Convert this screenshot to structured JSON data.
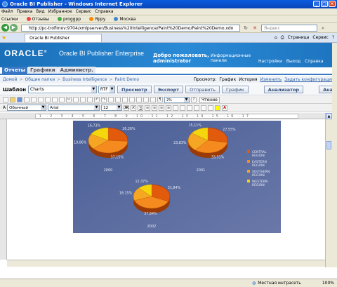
{
  "window": {
    "title": "Oracle BI Publisher - Windows Internet Explorer"
  },
  "menu": [
    "Файл",
    "Правка",
    "Вид",
    "Избранное",
    "Сервис",
    "Справка"
  ],
  "links_bar": [
    "Ссылки",
    "Отзывы",
    "proggpp",
    "Ярру",
    "Москва"
  ],
  "address": {
    "url": "http://pc-trofimov:9704/xmlpserver/Business%20Intelligence/Paint%20Demo/Paint%20Demo.xdo",
    "search_placeholder": "Яндекс"
  },
  "browser_tab": {
    "label": "Oracle BI Publisher",
    "tools": [
      "Страница",
      "Сервис"
    ]
  },
  "banner": {
    "brand": "ORACLE",
    "product": "Oracle BI Publisher Enterprise",
    "welcome_line1": "Добро пожаловать,",
    "welcome_line2": "administrator",
    "info_panel_line1": "Информационные",
    "info_panel_line2": "панели",
    "links": [
      "Настройки",
      "Выход",
      "Справка"
    ]
  },
  "app_tabs": [
    {
      "label": "Отчеты",
      "active": true
    },
    {
      "label": "Графики",
      "active": false
    },
    {
      "label": "Администр.",
      "active": false
    }
  ],
  "breadcrumb": {
    "items": [
      "Домой",
      "Общие папки",
      "Business Intelligence",
      "Paint Demo"
    ]
  },
  "view_links": {
    "label": "Просмотр:",
    "items": [
      "График",
      "История",
      "Изменить",
      "Задать конфигурацию"
    ]
  },
  "template_bar": {
    "label": "Шаблон",
    "template_value": "Charts",
    "format_value": "RTF",
    "buttons": [
      "Просмотр",
      "Экспорт",
      "Отправить",
      "График",
      "Анализатор",
      "Ана"
    ]
  },
  "format_bar": {
    "style": "Обычный",
    "font": "Arial",
    "size": "12",
    "zoom": "2%",
    "reading": "Чтение"
  },
  "status": {
    "zone": "Местная интрасеть",
    "zoom": "100%"
  },
  "chart_data": [
    {
      "type": "pie",
      "title": "2000",
      "categories": [
        "CENTRAL REGION",
        "EASTERN REGION",
        "SOUTHERN REGION",
        "WESTERN REGION"
      ],
      "values": [
        26.26,
        37.15,
        19.86,
        16.73
      ],
      "labels": [
        "26,26%",
        "37,15%",
        "19,86%",
        "16,73%"
      ],
      "legend": "right",
      "colors": [
        "#e25b0c",
        "#f58a1e",
        "#f5a623",
        "#f5d60c"
      ]
    },
    {
      "type": "pie",
      "title": "2001",
      "categories": [
        "CENTRAL REGION",
        "EASTERN REGION",
        "SOUTHERN REGION",
        "WESTERN REGION"
      ],
      "values": [
        27.55,
        33.51,
        23.83,
        15.11
      ],
      "labels": [
        "27,55%",
        "33,51%",
        "23,83%",
        "15,11%"
      ],
      "legend": "right",
      "colors": [
        "#e25b0c",
        "#f58a1e",
        "#f5a623",
        "#f5d60c"
      ]
    },
    {
      "type": "pie",
      "title": "2002",
      "categories": [
        "CENTRAL REGION",
        "EASTERN REGION",
        "SOUTHERN REGION",
        "WESTERN REGION"
      ],
      "values": [
        31.84,
        37.84,
        18.15,
        12.37
      ],
      "labels": [
        "31,84%",
        "37,84%",
        "18,15%",
        "12,37%"
      ],
      "legend": "right",
      "colors": [
        "#e25b0c",
        "#f58a1e",
        "#f5a623",
        "#f5d60c"
      ]
    }
  ],
  "legend": {
    "items": [
      {
        "line1": "CENTRAL",
        "line2": "REGION"
      },
      {
        "line1": "EASTERN",
        "line2": "REGION"
      },
      {
        "line1": "SOUTHERN",
        "line2": "REGION"
      },
      {
        "line1": "WESTERN",
        "line2": "REGION"
      }
    ]
  }
}
